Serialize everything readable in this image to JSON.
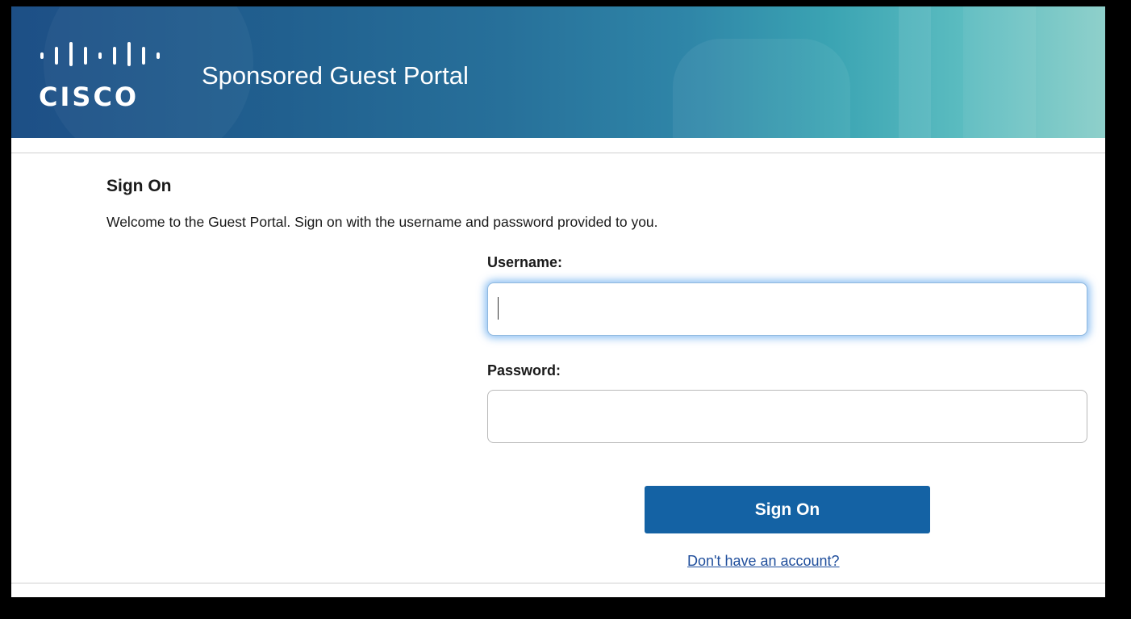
{
  "header": {
    "logo_text": "CISCO",
    "title": "Sponsored Guest Portal"
  },
  "signon": {
    "heading": "Sign On",
    "welcome": "Welcome to the Guest Portal. Sign on with the username and password provided to you.",
    "username_label": "Username:",
    "username_value": "",
    "password_label": "Password:",
    "password_value": "",
    "button_label": "Sign On",
    "account_link": "Don't have an account?"
  },
  "colors": {
    "banner_dark": "#1d4f86",
    "banner_light": "#8fd0cb",
    "button": "#1462a4",
    "link": "#1f4e9c",
    "focus_glow": "#66aaee"
  },
  "icons": {
    "logo": "cisco-logo-icon"
  }
}
